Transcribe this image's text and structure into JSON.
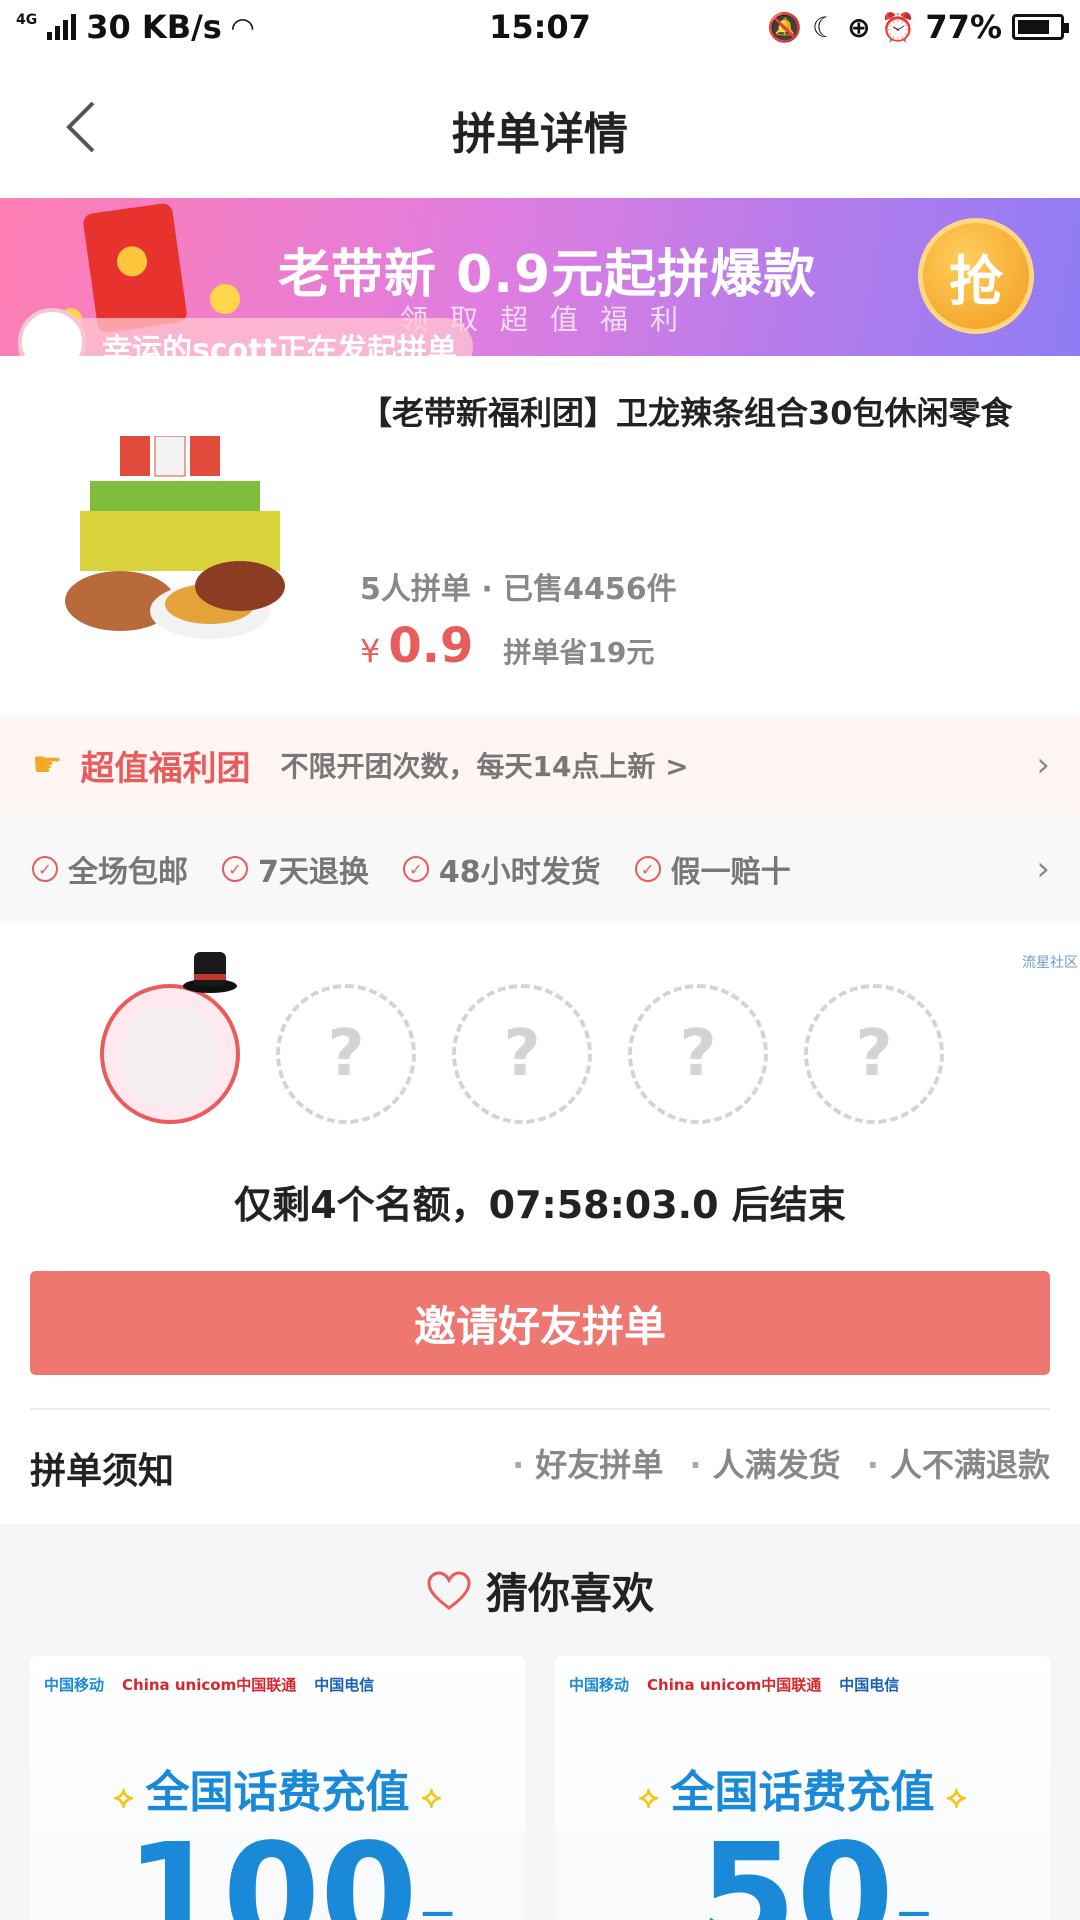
{
  "status_bar": {
    "network": "4G",
    "speed": "30 KB/s",
    "time": "15:07",
    "battery": "77%",
    "battery_level": 0.77
  },
  "header": {
    "title": "拼单详情"
  },
  "banner": {
    "title": "老带新  0.9元起拼爆款",
    "subtitle": "领取超值福利",
    "grab_label": "抢",
    "initiator": "幸运的scott正在发起拼单"
  },
  "product": {
    "name": "【老带新福利团】卫龙辣条组合30包休闲零食",
    "group_size": "5人拼单",
    "sold": "已售4456件",
    "currency": "¥",
    "price": "0.9",
    "saving": "拼单省19元"
  },
  "welfare": {
    "title": "超值福利团",
    "desc": "不限开团次数，每天14点上新 >"
  },
  "guarantees": [
    "全场包邮",
    "7天退换",
    "48小时发货",
    "假一赔十"
  ],
  "group": {
    "watermark": "流星社区",
    "empty_slot_mark": "?",
    "remaining": "仅剩4个名额，07:58:03.0 后结束",
    "invite_label": "邀请好友拼单",
    "rules_title": "拼单须知",
    "rules": [
      "好友拼单",
      "人满发货",
      "人不满退款"
    ]
  },
  "recommend": {
    "title": "猜你喜欢",
    "cards": [
      {
        "cm": "中国移动",
        "cu": "China unicom中国联通",
        "ct": "中国电信",
        "title": "全国话费充值",
        "currency": "¥",
        "amount": "100",
        "unit": "元"
      },
      {
        "cm": "中国移动",
        "cu": "China unicom中国联通",
        "ct": "中国电信",
        "title": "全国话费充值",
        "currency": "¥",
        "amount": "50",
        "unit": "元"
      }
    ]
  },
  "colors": {
    "accent": "#e85c5c",
    "button": "#ee7772",
    "banner_from": "#ff7eb3",
    "banner_to": "#8f7cf5"
  }
}
